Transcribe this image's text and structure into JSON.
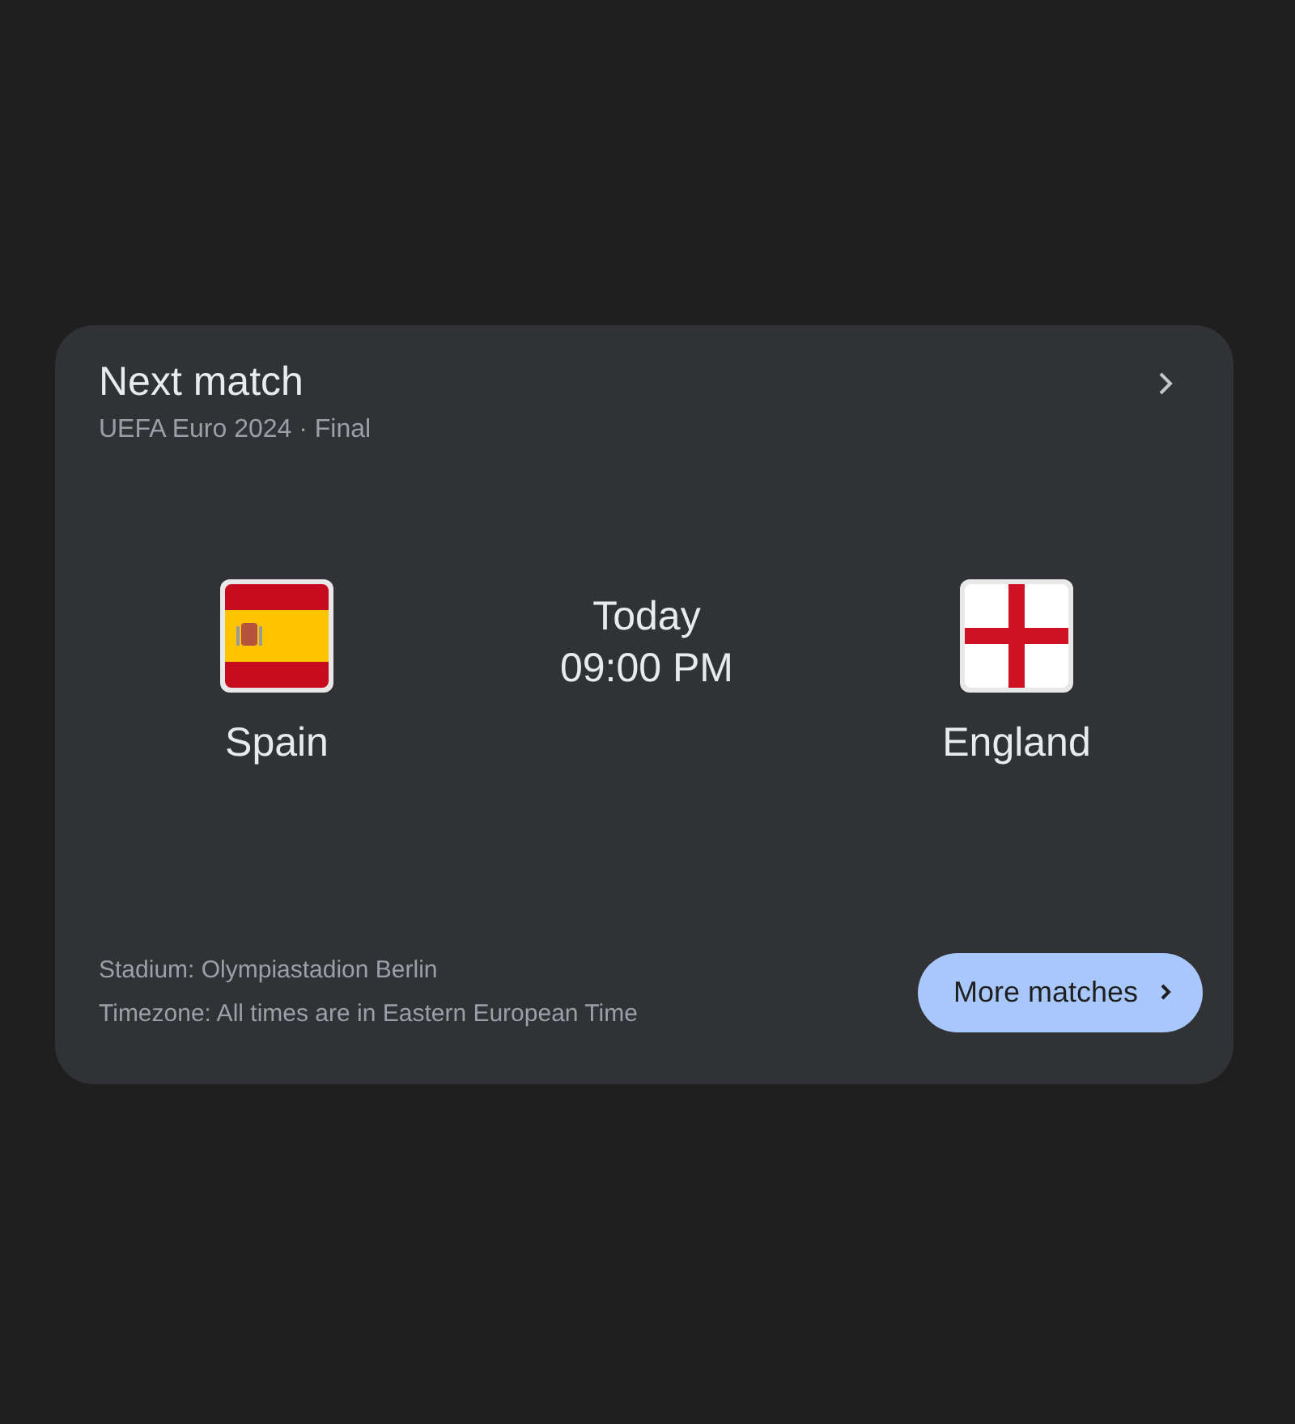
{
  "card": {
    "title": "Next match",
    "subtitle": "UEFA Euro 2024 · Final"
  },
  "teams": [
    {
      "name": "Spain",
      "kind": "spain"
    },
    {
      "name": "England",
      "kind": "england"
    }
  ],
  "kickoff": {
    "day": "Today",
    "time": "09:00 PM"
  },
  "details": [
    "Stadium: Olympiastadion Berlin",
    "Timezone: All times are in Eastern European Time"
  ],
  "button": {
    "label": "More matches"
  }
}
